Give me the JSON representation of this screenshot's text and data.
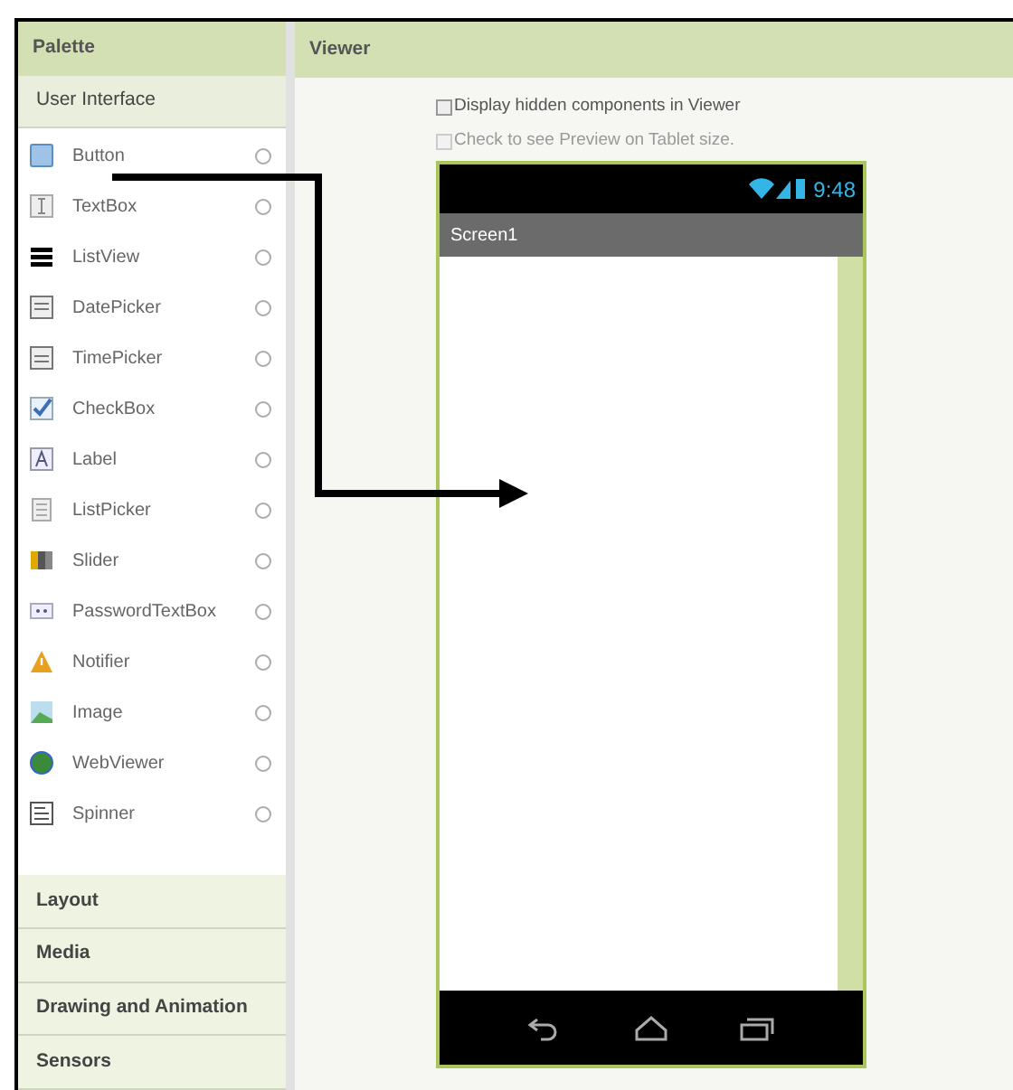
{
  "palette": {
    "title": "Palette",
    "sections": [
      {
        "title": "User Interface",
        "expanded": true,
        "items": [
          {
            "label": "Button"
          },
          {
            "label": "TextBox"
          },
          {
            "label": "ListView"
          },
          {
            "label": "DatePicker"
          },
          {
            "label": "TimePicker"
          },
          {
            "label": "CheckBox"
          },
          {
            "label": "Label"
          },
          {
            "label": "ListPicker"
          },
          {
            "label": "Slider"
          },
          {
            "label": "PasswordTextBox"
          },
          {
            "label": "Notifier"
          },
          {
            "label": "Image"
          },
          {
            "label": "WebViewer"
          },
          {
            "label": "Spinner"
          }
        ]
      },
      {
        "title": "Layout",
        "expanded": false
      },
      {
        "title": "Media",
        "expanded": false
      },
      {
        "title": "Drawing and Animation",
        "expanded": false
      },
      {
        "title": "Sensors",
        "expanded": false
      }
    ]
  },
  "viewer": {
    "title": "Viewer",
    "options": [
      {
        "label": "Display hidden components in Viewer",
        "checked": false,
        "disabled": false
      },
      {
        "label": "Check to see Preview on Tablet size.",
        "checked": false,
        "disabled": true
      }
    ],
    "phone": {
      "time": "9:48",
      "screen_title": "Screen1"
    }
  }
}
